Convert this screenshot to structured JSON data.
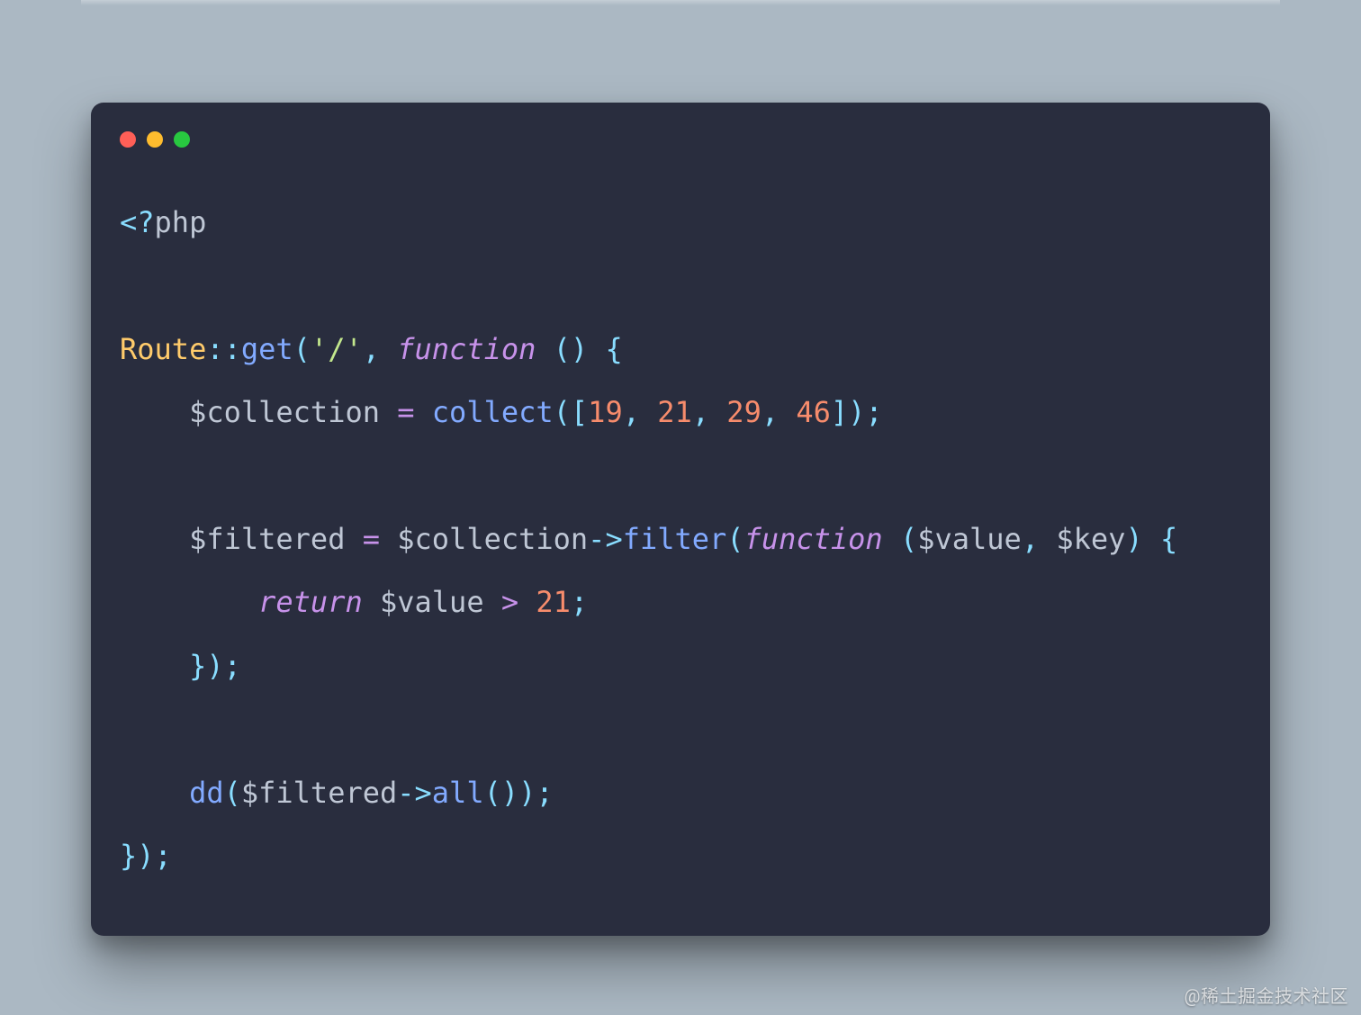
{
  "language": "php",
  "watermark": "@稀土掘金技术社区",
  "window": {
    "dots": [
      "red",
      "yellow",
      "green"
    ]
  },
  "code": {
    "route_path": "'/'",
    "collection_values": [
      19,
      21,
      29,
      46
    ],
    "compare_value": 21,
    "tokens": {
      "lt_q": "<?",
      "php": "php",
      "Route": "Route",
      "dbl_colon": "::",
      "get": "get",
      "lparen": "(",
      "rparen": ")",
      "comma_sp": ", ",
      "function": "function",
      "space": " ",
      "lbrace": "{",
      "rbrace": "}",
      "semicolon": ";",
      "dollar_collection": "$collection",
      "dollar_filtered": "$filtered",
      "dollar_value": "$value",
      "dollar_key": "$key",
      "eq": " = ",
      "collect": "collect",
      "lbracket": "[",
      "rbracket": "]",
      "arrow": "->",
      "filter": "filter",
      "return": "return",
      "gt": " > ",
      "dd": "dd",
      "all": "all",
      "indent1": "    ",
      "indent2": "        ",
      "n19": "19",
      "n21": "21",
      "n29": "29",
      "n46": "46",
      "cmp21": "21"
    }
  }
}
